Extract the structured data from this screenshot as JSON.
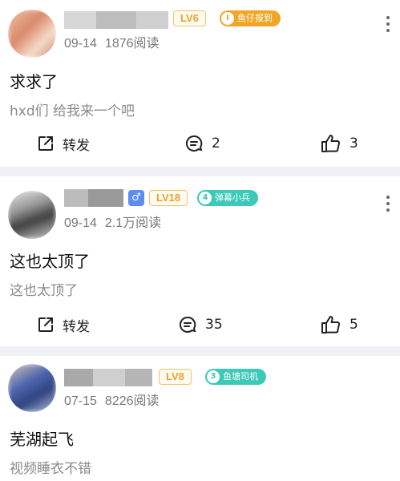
{
  "posts": [
    {
      "date": "09-14",
      "views": "1876阅读",
      "level": "LV6",
      "fan_number": "I",
      "fan_badge": "鱼仔报到",
      "fan_color": "#f0a728",
      "title": "求求了",
      "body": "hxd们 给我来一个吧",
      "share_label": "转发",
      "comment_count": "2",
      "like_count": "3",
      "avatar_colors": [
        "#e8a98c",
        "#c97a5d",
        "#f3d0bd"
      ]
    },
    {
      "date": "09-14",
      "views": "2.1万阅读",
      "level": "LV18",
      "gender_symbol": "♂",
      "fan_number": "4",
      "fan_badge": "弹幕小兵",
      "fan_color": "#3cc9b8",
      "title": "这也太顶了",
      "body": "这也太顶了",
      "share_label": "转发",
      "comment_count": "35",
      "like_count": "5",
      "avatar_colors": [
        "#8a8a8a",
        "#d9d9d9",
        "#4a4a4a"
      ]
    },
    {
      "date": "07-15",
      "views": "8226阅读",
      "level": "LV8",
      "fan_number": "3",
      "fan_badge": "鱼塘司机",
      "fan_color": "#3cc9b8",
      "title": "芜湖起飞",
      "body": "视频睡衣不错",
      "avatar_colors": [
        "#3d5aa8",
        "#9bb0e0",
        "#e8d6c8"
      ]
    }
  ]
}
